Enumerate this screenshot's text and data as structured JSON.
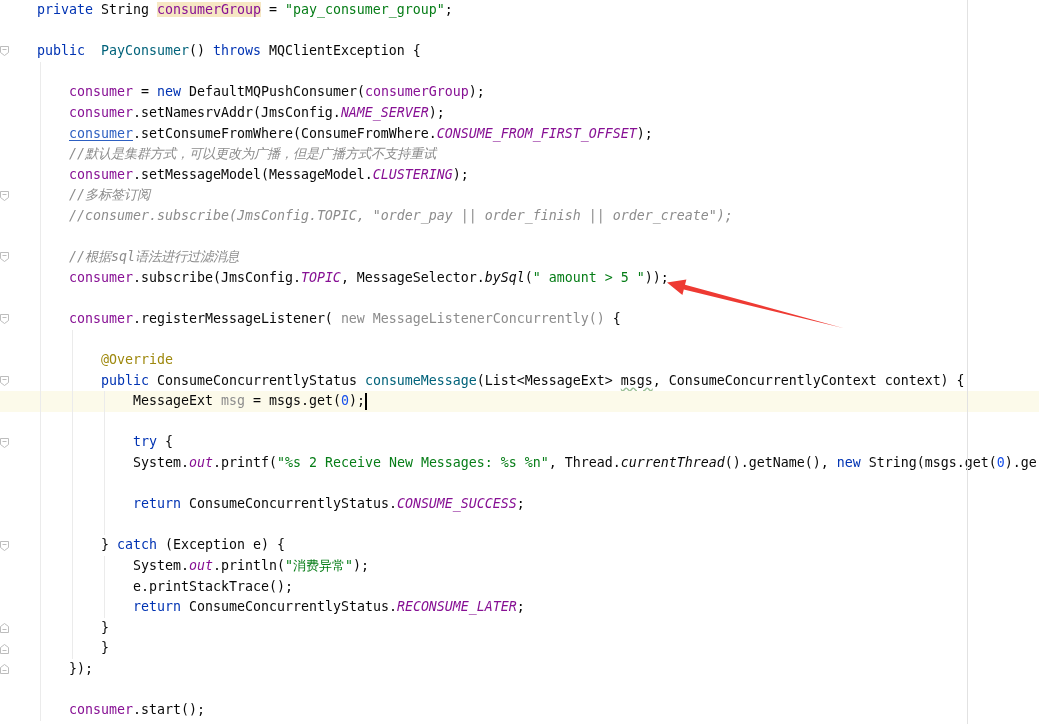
{
  "lines": [
    {
      "kind": "code",
      "tokens": [
        {
          "text": "private",
          "kind": "keyword"
        },
        {
          "text": " String ",
          "kind": "plain"
        },
        {
          "text": "consumerGroup",
          "kind": "field",
          "highlighted": true
        },
        {
          "text": " = ",
          "kind": "plain"
        },
        {
          "text": "\"pay_consumer_group\"",
          "kind": "string"
        },
        {
          "text": ";",
          "kind": "plain"
        }
      ]
    },
    {
      "kind": "blank"
    },
    {
      "kind": "code",
      "fold_start": true,
      "tokens": [
        {
          "text": "public",
          "kind": "keyword"
        },
        {
          "text": "  PayConsumer",
          "kind": "declaration"
        },
        {
          "text": "() ",
          "kind": "plain"
        },
        {
          "text": "throws",
          "kind": "keyword"
        },
        {
          "text": " MQClientException {",
          "kind": "plain"
        }
      ],
      "children": [
        {
          "kind": "blank"
        },
        {
          "kind": "code",
          "tokens": [
            {
              "text": "consumer",
              "kind": "field"
            },
            {
              "text": " = ",
              "kind": "plain"
            },
            {
              "text": "new",
              "kind": "keyword"
            },
            {
              "text": " DefaultMQPushConsumer(",
              "kind": "plain"
            },
            {
              "text": "consumerGroup",
              "kind": "field"
            },
            {
              "text": ");",
              "kind": "plain"
            }
          ]
        },
        {
          "kind": "code",
          "tokens": [
            {
              "text": "consumer",
              "kind": "field"
            },
            {
              "text": ".setNamesrvAddr(JmsConfig.",
              "kind": "plain"
            },
            {
              "text": "NAME_SERVER",
              "kind": "static_field"
            },
            {
              "text": ");",
              "kind": "plain"
            }
          ]
        },
        {
          "kind": "code",
          "tokens": [
            {
              "text": "consumer",
              "kind": "field",
              "link": true
            },
            {
              "text": ".setConsumeFromWhere(ConsumeFromWhere.",
              "kind": "plain"
            },
            {
              "text": "CONSUME_FROM_FIRST_OFFSET",
              "kind": "static_field"
            },
            {
              "text": ");",
              "kind": "plain"
            }
          ]
        },
        {
          "kind": "code",
          "tokens": [
            {
              "text": "//默认是集群方式，可以更改为广播，但是广播方式不支持重试",
              "kind": "comment"
            }
          ]
        },
        {
          "kind": "code",
          "tokens": [
            {
              "text": "consumer",
              "kind": "field"
            },
            {
              "text": ".setMessageModel(MessageModel.",
              "kind": "plain"
            },
            {
              "text": "CLUSTERING",
              "kind": "static_field"
            },
            {
              "text": ");",
              "kind": "plain"
            }
          ]
        },
        {
          "kind": "code",
          "fold_start": true,
          "tokens": [
            {
              "text": "//多标签订阅",
              "kind": "comment"
            }
          ]
        },
        {
          "kind": "code",
          "tokens": [
            {
              "text": "//consumer.subscribe(JmsConfig.TOPIC, \"order_pay || order_finish || order_create\");",
              "kind": "comment"
            }
          ]
        },
        {
          "kind": "blank"
        },
        {
          "kind": "code",
          "fold_start": true,
          "tokens": [
            {
              "text": "//根据sql语法进行过滤消息",
              "kind": "comment"
            }
          ]
        },
        {
          "kind": "code",
          "tokens": [
            {
              "text": "consumer",
              "kind": "field"
            },
            {
              "text": ".subscribe(JmsConfig.",
              "kind": "plain"
            },
            {
              "text": "TOPIC",
              "kind": "static_field"
            },
            {
              "text": ", MessageSelector.",
              "kind": "plain"
            },
            {
              "text": "bySql",
              "kind": "static_call"
            },
            {
              "text": "(",
              "kind": "plain"
            },
            {
              "text": "\" amount > 5 \"",
              "kind": "string"
            },
            {
              "text": "));",
              "kind": "plain"
            }
          ]
        },
        {
          "kind": "blank"
        },
        {
          "kind": "code",
          "fold_start": true,
          "tokens": [
            {
              "text": "consumer",
              "kind": "field"
            },
            {
              "text": ".registerMessageListener( ",
              "kind": "plain"
            },
            {
              "text": "new MessageListenerConcurrently()",
              "kind": "faded"
            },
            {
              "text": " {",
              "kind": "plain"
            }
          ],
          "children": [
            {
              "kind": "blank"
            },
            {
              "kind": "code",
              "tokens": [
                {
                  "text": "@Override",
                  "kind": "annotation"
                }
              ]
            },
            {
              "kind": "code",
              "fold_start": true,
              "tokens": [
                {
                  "text": "public",
                  "kind": "keyword"
                },
                {
                  "text": " ConsumeConcurrentlyStatus ",
                  "kind": "plain"
                },
                {
                  "text": "consumeMessage",
                  "kind": "declaration"
                },
                {
                  "text": "(List<MessageExt> ",
                  "kind": "plain"
                },
                {
                  "text": "msgs",
                  "kind": "plain",
                  "warning": true
                },
                {
                  "text": ", ConsumeConcurrentlyContext context) {",
                  "kind": "plain"
                }
              ],
              "children": [
                {
                  "kind": "code",
                  "current": true,
                  "tokens": [
                    {
                      "text": "MessageExt ",
                      "kind": "plain"
                    },
                    {
                      "text": "msg",
                      "kind": "faded"
                    },
                    {
                      "text": " = msgs.get(",
                      "kind": "plain"
                    },
                    {
                      "text": "0",
                      "kind": "number"
                    },
                    {
                      "text": ");",
                      "kind": "plain"
                    }
                  ]
                },
                {
                  "kind": "blank"
                },
                {
                  "kind": "code",
                  "fold_start": true,
                  "tokens": [
                    {
                      "text": "try",
                      "kind": "keyword"
                    },
                    {
                      "text": " {",
                      "kind": "plain"
                    }
                  ]
                },
                {
                  "kind": "code",
                  "tokens": [
                    {
                      "text": "System.",
                      "kind": "plain"
                    },
                    {
                      "text": "out",
                      "kind": "static_field"
                    },
                    {
                      "text": ".printf(",
                      "kind": "plain"
                    },
                    {
                      "text": "\"%s 2 Receive New Messages: %s %n\"",
                      "kind": "string"
                    },
                    {
                      "text": ", Thread.",
                      "kind": "plain"
                    },
                    {
                      "text": "currentThread",
                      "kind": "static_call"
                    },
                    {
                      "text": "().getName(), ",
                      "kind": "plain"
                    },
                    {
                      "text": "new",
                      "kind": "keyword"
                    },
                    {
                      "text": " String(msgs.get(",
                      "kind": "plain"
                    },
                    {
                      "text": "0",
                      "kind": "number"
                    },
                    {
                      "text": ").ge",
                      "kind": "plain"
                    }
                  ]
                },
                {
                  "kind": "blank"
                },
                {
                  "kind": "code",
                  "tokens": [
                    {
                      "text": "return",
                      "kind": "keyword"
                    },
                    {
                      "text": " ConsumeConcurrentlyStatus.",
                      "kind": "plain"
                    },
                    {
                      "text": "CONSUME_SUCCESS",
                      "kind": "static_field"
                    },
                    {
                      "text": ";",
                      "kind": "plain"
                    }
                  ]
                },
                {
                  "kind": "blank"
                }
              ]
            },
            {
              "kind": "code",
              "fold_start": true,
              "tokens": [
                {
                  "text": "} ",
                  "kind": "plain"
                },
                {
                  "text": "catch",
                  "kind": "keyword"
                },
                {
                  "text": " (Exception e) {",
                  "kind": "plain"
                }
              ],
              "children": [
                {
                  "kind": "code",
                  "tokens": [
                    {
                      "text": "System.",
                      "kind": "plain"
                    },
                    {
                      "text": "out",
                      "kind": "static_field"
                    },
                    {
                      "text": ".println(",
                      "kind": "plain"
                    },
                    {
                      "text": "\"消费异常\"",
                      "kind": "string"
                    },
                    {
                      "text": ");",
                      "kind": "plain"
                    }
                  ]
                },
                {
                  "kind": "code",
                  "tokens": [
                    {
                      "text": "e.printStackTrace();",
                      "kind": "plain"
                    }
                  ]
                },
                {
                  "kind": "code",
                  "tokens": [
                    {
                      "text": "return",
                      "kind": "keyword"
                    },
                    {
                      "text": " ConsumeConcurrentlyStatus.",
                      "kind": "plain"
                    },
                    {
                      "text": "RECONSUME_LATER",
                      "kind": "static_field"
                    },
                    {
                      "text": ";",
                      "kind": "plain"
                    }
                  ]
                }
              ]
            },
            {
              "kind": "code",
              "fold_end": true,
              "tokens": [
                {
                  "text": "}",
                  "kind": "plain"
                }
              ]
            },
            {
              "kind": "code",
              "fold_end": true,
              "tokens": [
                {
                  "text": "}",
                  "kind": "plain"
                }
              ]
            }
          ]
        },
        {
          "kind": "code",
          "fold_end": true,
          "tokens": [
            {
              "text": "});",
              "kind": "plain"
            }
          ]
        },
        {
          "kind": "blank"
        },
        {
          "kind": "code",
          "tokens": [
            {
              "text": "consumer",
              "kind": "field"
            },
            {
              "text": ".start();",
              "kind": "plain"
            }
          ]
        }
      ]
    }
  ]
}
